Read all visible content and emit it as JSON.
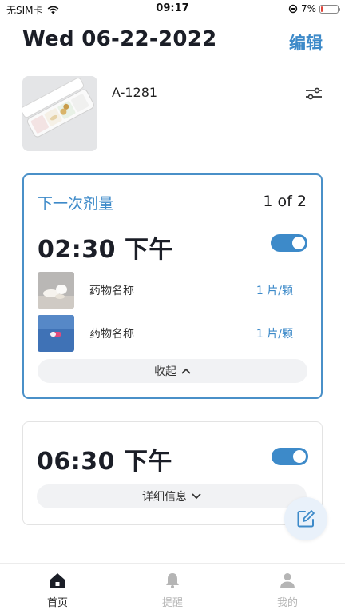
{
  "status_bar": {
    "carrier": "无SIM卡",
    "time": "09:17",
    "battery": "7%",
    "battery_level": 0.07
  },
  "header": {
    "date": "Wed 06-22-2022",
    "edit_label": "编辑"
  },
  "device": {
    "name": "A-1281"
  },
  "next_dose_card": {
    "label": "下一次剂量",
    "counter": "1 of 2",
    "time": "02:30 下午",
    "enabled": true,
    "medications": [
      {
        "name": "药物名称",
        "dose": "1 片/颗"
      },
      {
        "name": "药物名称",
        "dose": "1 片/颗"
      }
    ],
    "collapse_label": "收起"
  },
  "second_dose_card": {
    "time": "06:30 下午",
    "enabled": true,
    "details_label": "详细信息"
  },
  "tab_bar": {
    "tabs": [
      {
        "label": "首页",
        "icon": "home-icon",
        "selected": true
      },
      {
        "label": "提醒",
        "icon": "bell-icon",
        "selected": false
      },
      {
        "label": "我的",
        "icon": "person-icon",
        "selected": false
      }
    ]
  },
  "colors": {
    "accent": "#3d8ac9",
    "title": "#1b1e27",
    "inactive_tab": "#b5b5b5"
  }
}
